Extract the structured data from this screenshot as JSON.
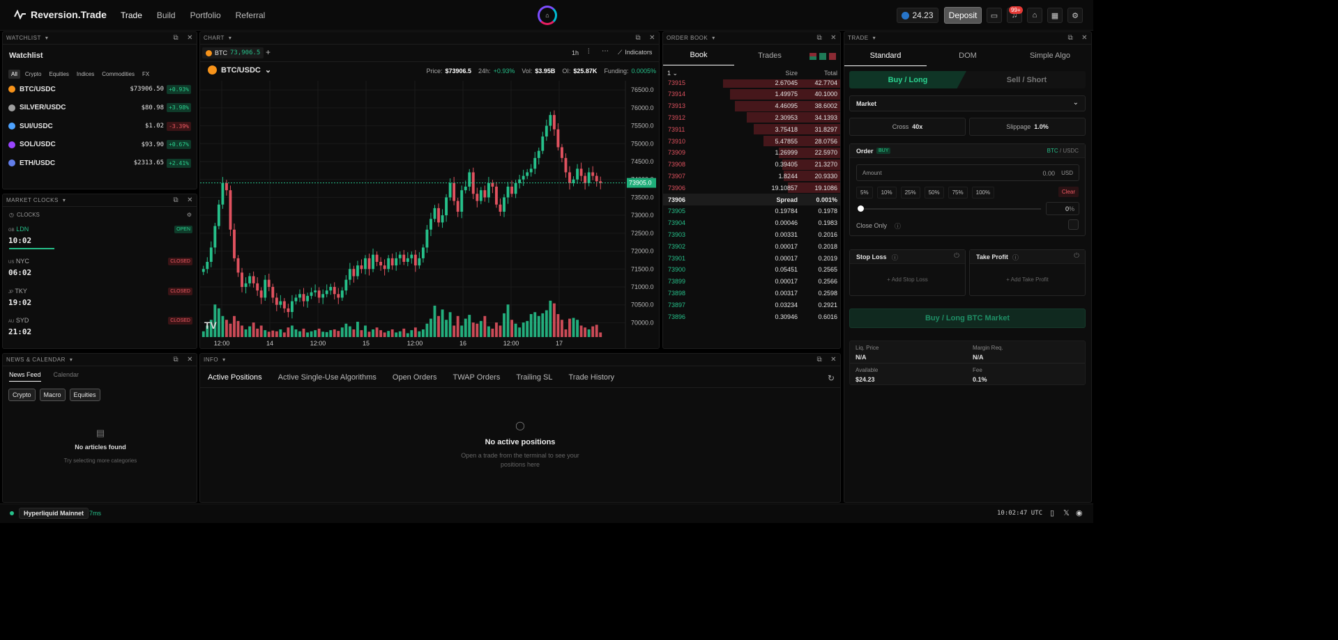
{
  "app": {
    "name": "Reversion.Trade"
  },
  "nav": [
    "Trade",
    "Build",
    "Portfolio",
    "Referral"
  ],
  "header": {
    "balance": "24.23",
    "deposit_label": "Deposit",
    "notifications_badge": "99+"
  },
  "watchlist": {
    "panel_title": "WATCHLIST",
    "title": "Watchlist",
    "filters": [
      "All",
      "Crypto",
      "Equities",
      "Indices",
      "Commodities",
      "FX"
    ],
    "items": [
      {
        "symbol": "BTC/USDC",
        "price": "$73906.50",
        "change": "+0.93%",
        "dir": "up",
        "color": "#f7931a"
      },
      {
        "symbol": "SILVER/USDC",
        "price": "$80.98",
        "change": "+3.98%",
        "dir": "up",
        "color": "#9e9e9e"
      },
      {
        "symbol": "SUI/USDC",
        "price": "$1.02",
        "change": "-3.39%",
        "dir": "down",
        "color": "#4da2ff"
      },
      {
        "symbol": "SOL/USDC",
        "price": "$93.90",
        "change": "+0.67%",
        "dir": "up",
        "color": "#9945ff"
      },
      {
        "symbol": "ETH/USDC",
        "price": "$2313.65",
        "change": "+2.41%",
        "dir": "up",
        "color": "#627eea"
      }
    ]
  },
  "clocks": {
    "panel_title": "MARKET CLOCKS",
    "label": "CLOCKS",
    "items": [
      {
        "flag": "GB",
        "city": "LDN",
        "time": "10:02",
        "status": "OPEN"
      },
      {
        "flag": "US",
        "city": "NYC",
        "time": "06:02",
        "status": "CLOSED"
      },
      {
        "flag": "JP",
        "city": "TKY",
        "time": "19:02",
        "status": "CLOSED"
      },
      {
        "flag": "AU",
        "city": "SYD",
        "time": "21:02",
        "status": "CLOSED"
      }
    ]
  },
  "news": {
    "panel_title": "NEWS & CALENDAR",
    "tabs": [
      "News Feed",
      "Calendar"
    ],
    "categories": [
      "Crypto",
      "Macro",
      "Equities"
    ],
    "empty_title": "No articles found",
    "empty_sub": "Try selecting more categories"
  },
  "chart": {
    "panel_title": "CHART",
    "tab_symbol": "BTC",
    "tab_price": "73,906.5",
    "timeframe": "1h",
    "indicators_label": "Indicators",
    "pair": "BTC/USDC",
    "stats": {
      "price_label": "Price:",
      "price": "$73906.5",
      "h24_label": "24h:",
      "h24": "+0.93%",
      "vol_label": "Vol:",
      "vol": "$3.95B",
      "oi_label": "OI:",
      "oi": "$25.87K",
      "funding_label": "Funding:",
      "funding": "0.0005%"
    },
    "last_price_label": "73905.0"
  },
  "chart_data": {
    "type": "candlestick",
    "title": "",
    "xlabel": "",
    "ylabel": "",
    "x_ticks": [
      "12:00",
      "14",
      "12:00",
      "15",
      "12:00",
      "16",
      "12:00",
      "17"
    ],
    "y_ticks": [
      76500.0,
      76000.0,
      75500.0,
      75000.0,
      74500.0,
      74000.0,
      73500.0,
      73000.0,
      72500.0,
      72000.0,
      71500.0,
      71000.0,
      70500.0,
      70000.0
    ],
    "ylim": [
      69600,
      76600
    ],
    "close": [
      71500,
      71700,
      72100,
      72700,
      73300,
      73900,
      73700,
      72600,
      71800,
      71400,
      71000,
      71100,
      71300,
      71100,
      70900,
      70700,
      71200,
      71000,
      70700,
      70500,
      70600,
      70400,
      70300,
      70600,
      70700,
      70800,
      70600,
      70750,
      70850,
      70900,
      70700,
      70800,
      70900,
      71000,
      70800,
      70700,
      70900,
      71200,
      71500,
      71300,
      71600,
      71500,
      71800,
      71500,
      71900,
      71700,
      71600,
      71500,
      71800,
      71600,
      71800,
      71900,
      71700,
      71800,
      71900,
      71600,
      71800,
      72100,
      72600,
      72900,
      73200,
      72800,
      73000,
      73500,
      73900,
      73400,
      73100,
      73700,
      73800,
      74200,
      73600,
      73400,
      73700,
      73500,
      73900,
      73800,
      73300,
      73100,
      73500,
      73800,
      73600,
      73900,
      74000,
      74100,
      74200,
      74300,
      74600,
      74800,
      75200,
      75500,
      75800,
      75400,
      74900,
      74600,
      74200,
      73900,
      74000,
      74300,
      74100,
      73900,
      74200,
      74100,
      73950,
      73905
    ],
    "volume": [
      0.15,
      0.3,
      0.45,
      0.85,
      0.75,
      0.55,
      0.45,
      0.35,
      0.55,
      0.42,
      0.3,
      0.2,
      0.28,
      0.38,
      0.22,
      0.3,
      0.18,
      0.14,
      0.17,
      0.15,
      0.2,
      0.12,
      0.25,
      0.3,
      0.2,
      0.15,
      0.22,
      0.12,
      0.15,
      0.18,
      0.22,
      0.14,
      0.13,
      0.18,
      0.2,
      0.16,
      0.25,
      0.35,
      0.28,
      0.2,
      0.4,
      0.18,
      0.3,
      0.14,
      0.2,
      0.25,
      0.18,
      0.12,
      0.16,
      0.2,
      0.12,
      0.15,
      0.22,
      0.1,
      0.18,
      0.25,
      0.15,
      0.2,
      0.35,
      0.48,
      0.82,
      0.55,
      0.72,
      0.45,
      0.65,
      0.3,
      0.55,
      0.3,
      0.48,
      0.58,
      0.38,
      0.35,
      0.42,
      0.55,
      0.28,
      0.22,
      0.38,
      0.3,
      0.62,
      0.85,
      0.45,
      0.35,
      0.25,
      0.38,
      0.42,
      0.6,
      0.65,
      0.55,
      0.62,
      0.7,
      0.95,
      0.88,
      0.6,
      0.45,
      0.2,
      0.48,
      0.5,
      0.45,
      0.3,
      0.25,
      0.2,
      0.28,
      0.32,
      0.12
    ]
  },
  "orderbook": {
    "panel_title": "ORDER BOOK",
    "tabs": [
      "Book",
      "Trades"
    ],
    "precision": "1",
    "size_label": "Size",
    "total_label": "Total",
    "asks": [
      {
        "price": "73915",
        "size": "2.67045",
        "total": "42.7704",
        "depth": 1.0
      },
      {
        "price": "73914",
        "size": "1.49975",
        "total": "40.1000",
        "depth": 0.94
      },
      {
        "price": "73913",
        "size": "4.46095",
        "total": "38.6002",
        "depth": 0.9
      },
      {
        "price": "73912",
        "size": "2.30953",
        "total": "34.1393",
        "depth": 0.8
      },
      {
        "price": "73911",
        "size": "3.75418",
        "total": "31.8297",
        "depth": 0.74
      },
      {
        "price": "73910",
        "size": "5.47855",
        "total": "28.0756",
        "depth": 0.66
      },
      {
        "price": "73909",
        "size": "1.26999",
        "total": "22.5970",
        "depth": 0.53
      },
      {
        "price": "73908",
        "size": "0.39405",
        "total": "21.3270",
        "depth": 0.5
      },
      {
        "price": "73907",
        "size": "1.8244",
        "total": "20.9330",
        "depth": 0.49
      },
      {
        "price": "73906",
        "size": "19.10857",
        "total": "19.1086",
        "depth": 0.45
      }
    ],
    "spread": {
      "price": "73906",
      "label": "Spread",
      "value": "0.001%"
    },
    "bids": [
      {
        "price": "73905",
        "size": "0.19784",
        "total": "0.1978"
      },
      {
        "price": "73904",
        "size": "0.00046",
        "total": "0.1983"
      },
      {
        "price": "73903",
        "size": "0.00331",
        "total": "0.2016"
      },
      {
        "price": "73902",
        "size": "0.00017",
        "total": "0.2018"
      },
      {
        "price": "73901",
        "size": "0.00017",
        "total": "0.2019"
      },
      {
        "price": "73900",
        "size": "0.05451",
        "total": "0.2565"
      },
      {
        "price": "73899",
        "size": "0.00017",
        "total": "0.2566"
      },
      {
        "price": "73898",
        "size": "0.00317",
        "total": "0.2598"
      },
      {
        "price": "73897",
        "size": "0.03234",
        "total": "0.2921"
      },
      {
        "price": "73896",
        "size": "0.30946",
        "total": "0.6016"
      }
    ]
  },
  "info": {
    "panel_title": "INFO",
    "tabs": [
      "Active Positions",
      "Active Single-Use Algorithms",
      "Open Orders",
      "TWAP Orders",
      "Trailing SL",
      "Trade History"
    ],
    "empty_title": "No active positions",
    "empty_sub_1": "Open a trade from the terminal to see your",
    "empty_sub_2": "positions here"
  },
  "trade": {
    "panel_title": "TRADE",
    "modes": [
      "Standard",
      "DOM",
      "Simple Algo"
    ],
    "buy_label": "Buy / Long",
    "sell_label": "Sell / Short",
    "order_type": "Market",
    "cross_label": "Cross",
    "cross_value": "40x",
    "slippage_label": "Slippage",
    "slippage_value": "1.0%",
    "order_label": "Order",
    "order_side": "BUY",
    "pair_base": "BTC",
    "pair_sep": " / USDC",
    "amount_placeholder": "Amount",
    "amount_value": "0.00",
    "amount_unit": "USD",
    "pcts": [
      "5%",
      "10%",
      "25%",
      "50%",
      "75%",
      "100%"
    ],
    "clear_label": "Clear",
    "slider_value": "0",
    "slider_unit": "%",
    "close_only_label": "Close Only",
    "stop_loss_label": "Stop Loss",
    "take_profit_label": "Take Profit",
    "add_stop_loss": "+ Add Stop Loss",
    "add_take_profit": "+ Add Take Profit",
    "submit_label": "Buy / Long BTC Market",
    "stats": [
      {
        "label": "Liq. Price",
        "value": "N/A"
      },
      {
        "label": "Margin Req.",
        "value": "N/A"
      },
      {
        "label": "Available",
        "value": "$24.23"
      },
      {
        "label": "Fee",
        "value": "0.1%"
      }
    ]
  },
  "footer": {
    "network": "Hyperliquid Mainnet",
    "latency": "7ms",
    "time": "10:02:47 UTC"
  },
  "colors": {
    "up": "#26c08a",
    "down": "#e0525f",
    "accent": "#2bd18f"
  }
}
